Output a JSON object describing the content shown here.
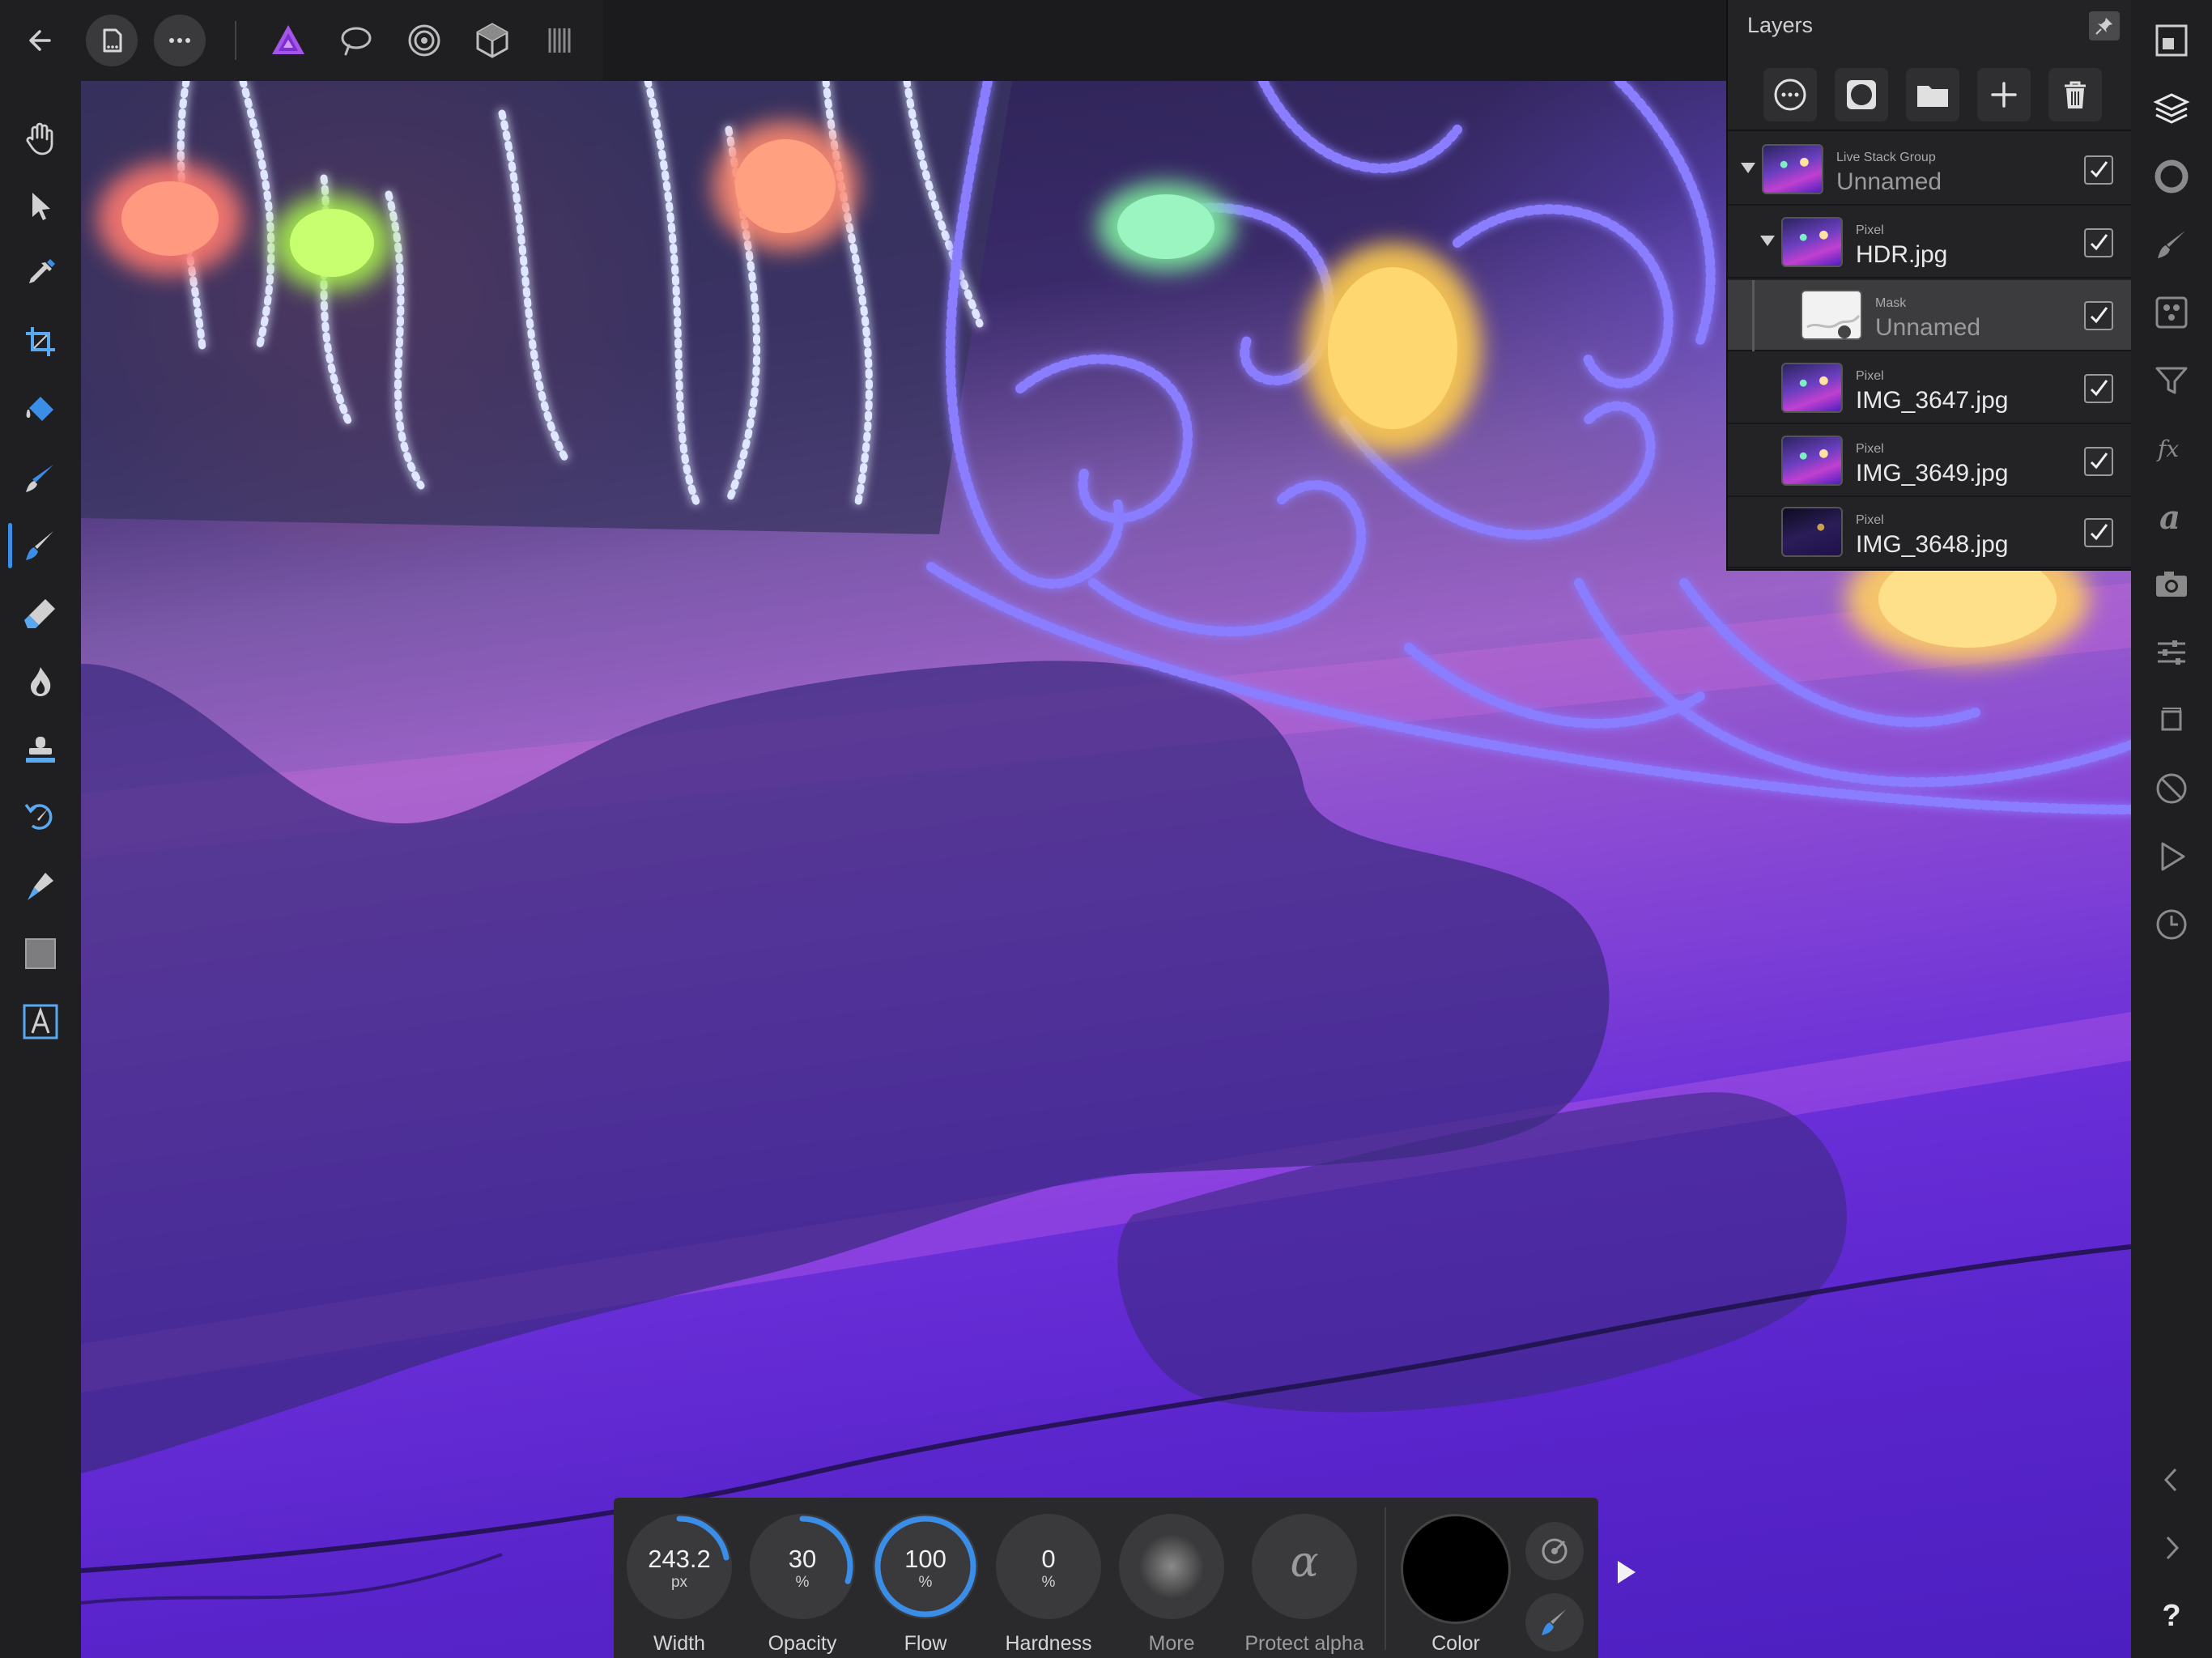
{
  "app": {
    "accent_color": "#3b8ee8"
  },
  "top_bar": {
    "icons": [
      "back-arrow-icon",
      "document-icon",
      "more-icon",
      "photo-persona-icon",
      "liquify-persona-icon",
      "develop-persona-icon",
      "tone-mapping-persona-icon",
      "export-persona-icon"
    ]
  },
  "left_tools": [
    "hand-tool-icon",
    "move-tool-icon",
    "color-picker-tool-icon",
    "crop-tool-icon",
    "flood-fill-tool-icon",
    "selection-brush-tool-icon",
    "paint-brush-tool-icon",
    "erase-brush-tool-icon",
    "dodge-brush-tool-icon",
    "clone-brush-tool-icon",
    "undo-brush-tool-icon",
    "pen-tool-icon",
    "rectangle-tool-icon",
    "text-tool-icon"
  ],
  "layers_panel": {
    "title": "Layers",
    "rows": [
      {
        "type": "Live Stack Group",
        "name": "Unnamed",
        "visible": true
      },
      {
        "type": "Pixel",
        "name": "HDR.jpg",
        "visible": true
      },
      {
        "type": "Mask",
        "name": "Unnamed",
        "visible": true
      },
      {
        "type": "Pixel",
        "name": "IMG_3647.jpg",
        "visible": true
      },
      {
        "type": "Pixel",
        "name": "IMG_3649.jpg",
        "visible": true
      },
      {
        "type": "Pixel",
        "name": "IMG_3648.jpg",
        "visible": true
      }
    ]
  },
  "context_bar": {
    "width": {
      "value": "243.2",
      "unit": "px",
      "label": "Width",
      "fraction": 0.22
    },
    "opacity": {
      "value": "30",
      "unit": "%",
      "label": "Opacity",
      "fraction": 0.3
    },
    "flow": {
      "value": "100",
      "unit": "%",
      "label": "Flow",
      "fraction": 1.0
    },
    "hardness": {
      "value": "0",
      "unit": "%",
      "label": "Hardness",
      "fraction": 0.0
    },
    "more": {
      "label": "More"
    },
    "protect_alpha": {
      "glyph": "α",
      "label": "Protect alpha"
    },
    "color": {
      "label": "Color",
      "value": "#000000"
    }
  },
  "help": {
    "label": "?"
  }
}
